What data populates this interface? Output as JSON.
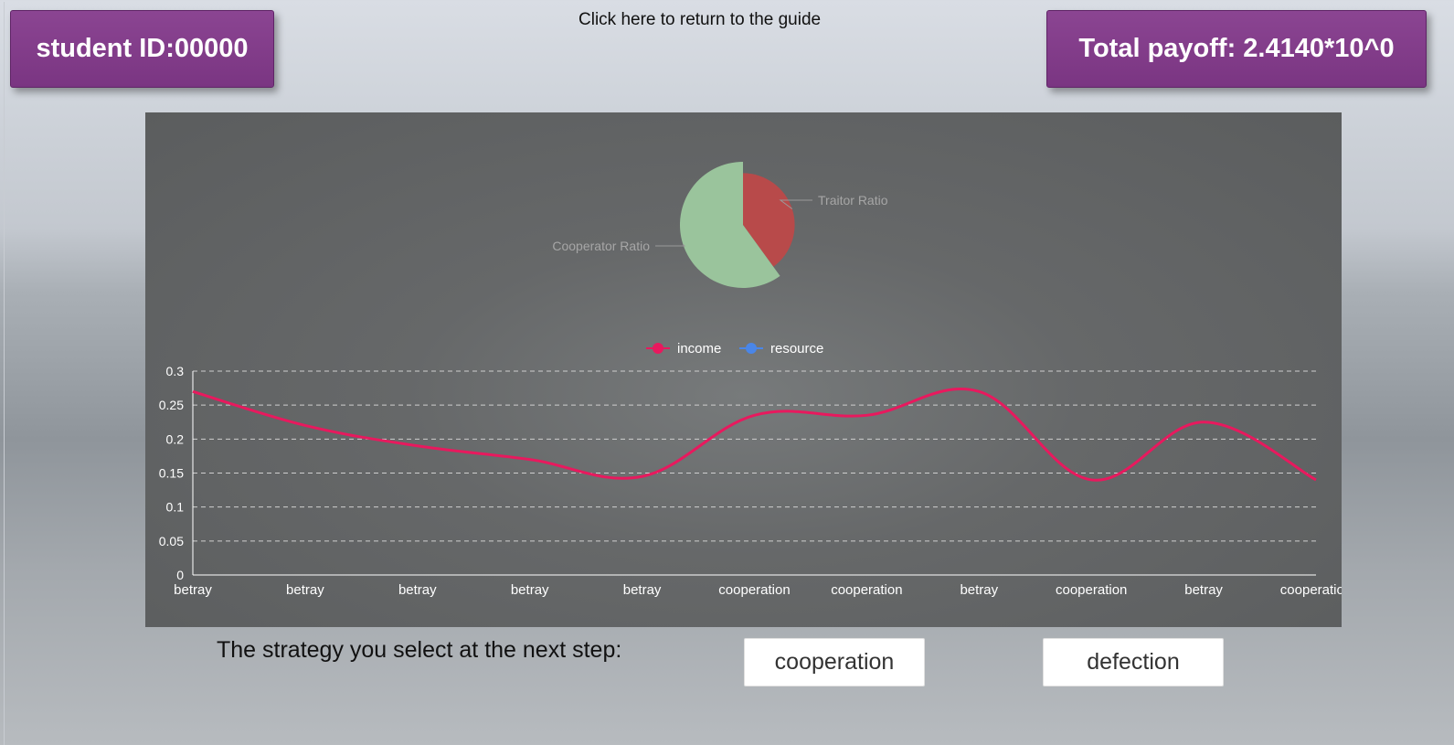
{
  "header": {
    "student_id": "student ID:00000",
    "guide_link": "Click here to return to the guide",
    "total_payoff": "Total payoff:  2.4140*10^0"
  },
  "colors": {
    "badge": "#7f3a87",
    "traitor": "#b84a4a",
    "cooperator": "#9ac49c",
    "income": "#e8195e",
    "resource": "#4a86e8"
  },
  "pie": {
    "slices": [
      {
        "name": "Traitor Ratio",
        "value": 0.4,
        "color": "#b84a4a"
      },
      {
        "name": "Cooperator Ratio",
        "value": 0.6,
        "color": "#9ac49c"
      }
    ]
  },
  "chart_data": {
    "type": "line",
    "categories": [
      "betray",
      "betray",
      "betray",
      "betray",
      "betray",
      "cooperation",
      "cooperation",
      "betray",
      "cooperation",
      "betray",
      "cooperation"
    ],
    "series": [
      {
        "name": "income",
        "values": [
          0.27,
          0.22,
          0.19,
          0.17,
          0.145,
          0.235,
          0.235,
          0.27,
          0.14,
          0.225,
          0.14
        ],
        "color": "#e8195e"
      },
      {
        "name": "resource",
        "values": [],
        "color": "#4a86e8"
      }
    ],
    "ylim": [
      0,
      0.3
    ],
    "yticks": [
      "0",
      "0.05",
      "0.1",
      "0.15",
      "0.2",
      "0.25",
      "0.3"
    ],
    "grid": true,
    "legend": "top-center"
  },
  "controls": {
    "prompt": "The strategy you select at the next step:",
    "cooperation_label": "cooperation",
    "defection_label": "defection"
  }
}
